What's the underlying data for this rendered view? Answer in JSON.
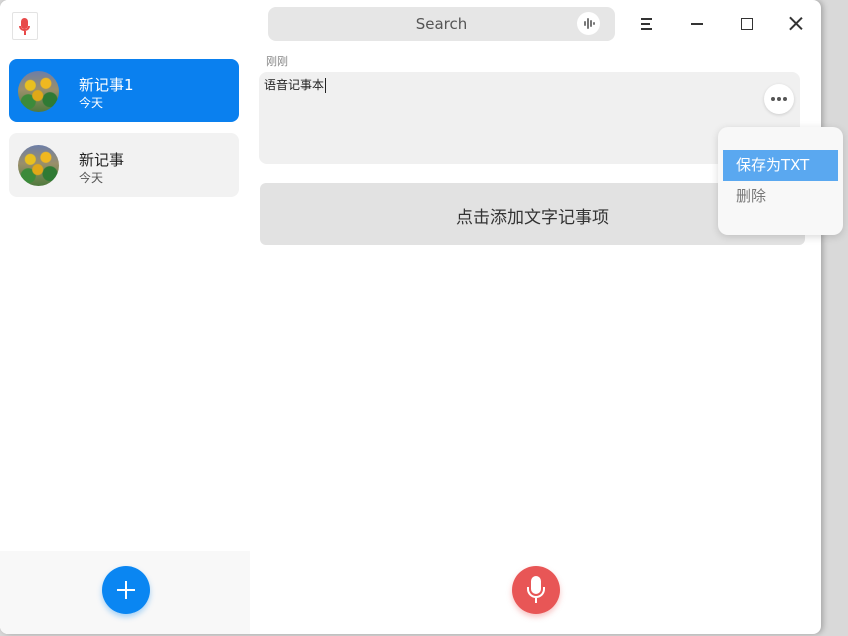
{
  "search": {
    "placeholder": "Search"
  },
  "sidebar": {
    "notes": [
      {
        "title": "新记事1",
        "date": "今天",
        "selected": true
      },
      {
        "title": "新记事",
        "date": "今天",
        "selected": false
      }
    ]
  },
  "content": {
    "time_label": "刚刚",
    "note_text": "语音记事本",
    "add_text_label": "点击添加文字记事项"
  },
  "context_menu": {
    "items": [
      {
        "label": "保存为TXT",
        "highlighted": true
      },
      {
        "label": "删除",
        "highlighted": false
      }
    ]
  },
  "colors": {
    "accent": "#0a80ef",
    "record": "#e85656",
    "menu_highlight": "#5aa8f0"
  }
}
